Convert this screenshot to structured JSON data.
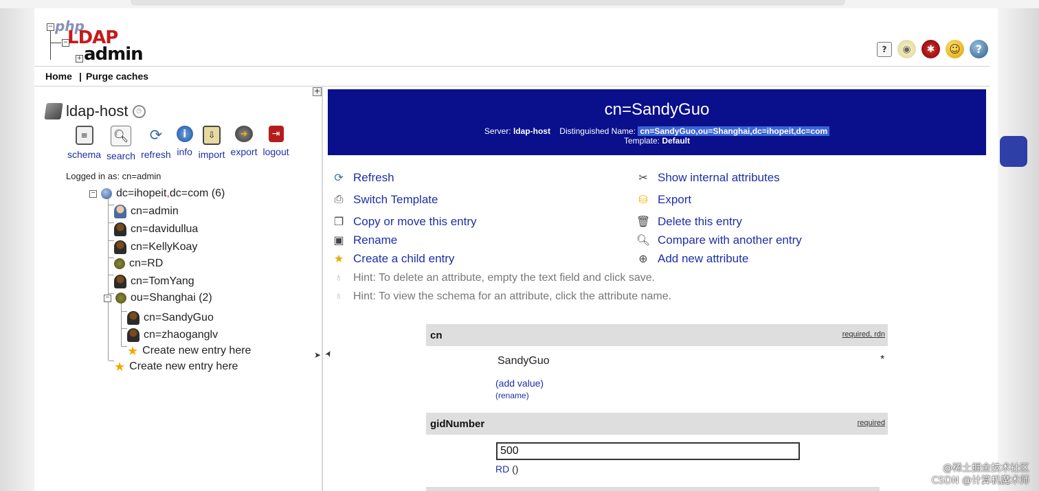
{
  "logo": {
    "php": "php",
    "ldap": "LDAP",
    "admin": "admin"
  },
  "top_icons": [
    "help-icon",
    "hint-bulb-icon",
    "bug-icon",
    "smiley-icon",
    "donate-icon"
  ],
  "menu": {
    "home": "Home",
    "sep": "|",
    "purge": "Purge caches"
  },
  "sidebar": {
    "host": "ldap-host",
    "tools": [
      {
        "label": "schema",
        "icon": "schema-icon"
      },
      {
        "label": "search",
        "icon": "search-icon"
      },
      {
        "label": "refresh",
        "icon": "refresh-icon"
      },
      {
        "label": "info",
        "icon": "info-icon"
      },
      {
        "label": "import",
        "icon": "import-icon"
      },
      {
        "label": "export",
        "icon": "export-icon"
      },
      {
        "label": "logout",
        "icon": "logout-icon"
      }
    ],
    "logged_in": "Logged in as: cn=admin",
    "tree": {
      "root": "dc=ihopeit",
      "root_comma": ",",
      "root_rest": "dc=com (6)",
      "children": [
        "cn=admin",
        "cn=davidullua",
        "cn=KellyKoay",
        "cn=RD",
        "cn=TomYang"
      ],
      "ou": "ou=Shanghai (2)",
      "ou_children": [
        "cn=SandyGuo",
        "cn=zhaoganglv"
      ],
      "create_inner": "Create new entry here",
      "create_outer": "Create new entry here"
    }
  },
  "entry": {
    "title": "cn=SandyGuo",
    "server_label": "Server:",
    "server": "ldap-host",
    "dn_label": "Distinguished Name:",
    "dn": "cn=SandyGuo,ou=Shanghai,dc=ihopeit,dc=com",
    "template_label": "Template:",
    "template": "Default"
  },
  "actions": {
    "left": [
      "Refresh",
      "Switch Template",
      "Copy or move this entry",
      "Rename",
      "Create a child entry"
    ],
    "right": [
      "Show internal attributes",
      "Export",
      "Delete this entry",
      "Compare with another entry",
      "Add new attribute"
    ],
    "hints": [
      "Hint: To delete an attribute, empty the text field and click save.",
      "Hint: To view the schema for an attribute, click the attribute name."
    ]
  },
  "attributes": {
    "cn": {
      "name": "cn",
      "flags_required": "required",
      "flags_sep": ", ",
      "flags_rdn": "rdn",
      "value": "SandyGuo",
      "marker": "*",
      "add_value": "add value",
      "rename": "rename"
    },
    "gid": {
      "name": "gidNumber",
      "flags": "required",
      "value": "500",
      "rd": "RD",
      "rd_paren": "()"
    }
  },
  "watermark": {
    "line1": "@稀土掘金技术社区",
    "line2": "CSDN @计算机魔术师"
  }
}
